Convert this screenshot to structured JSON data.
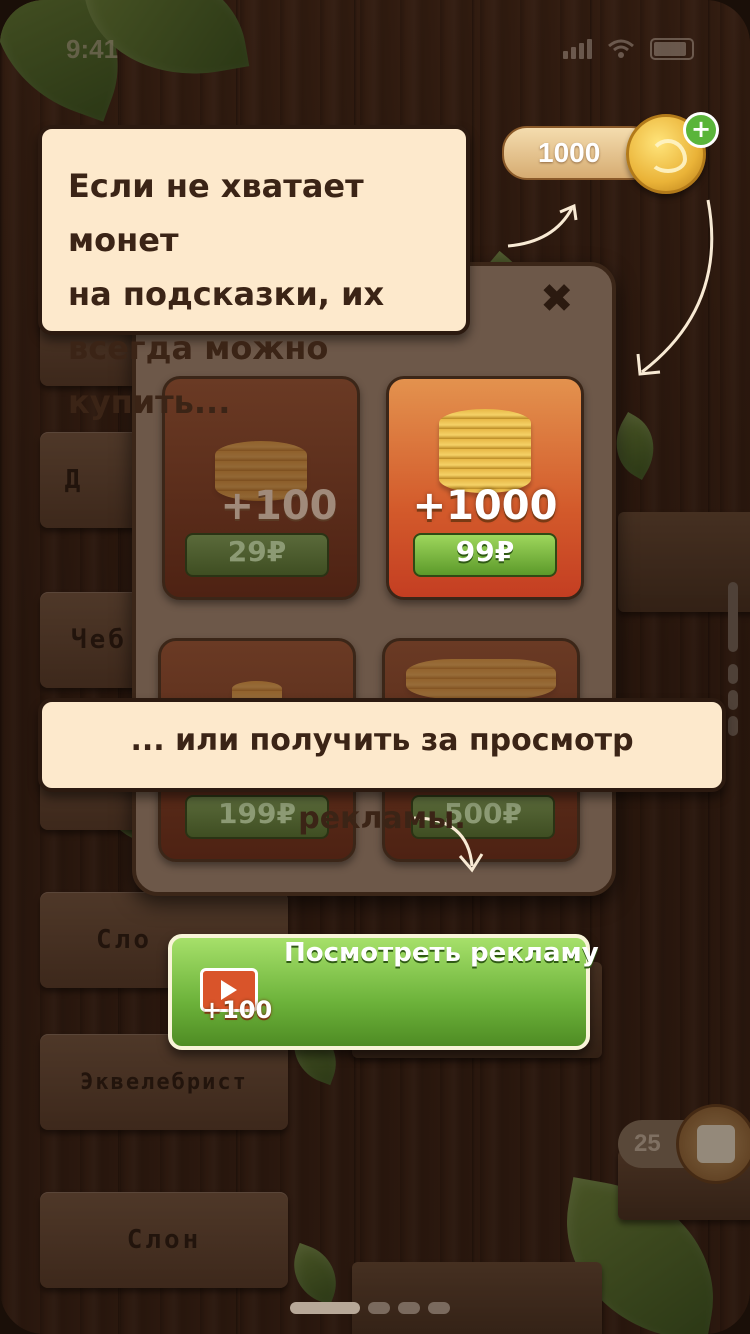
{
  "status_bar": {
    "time": "9:41"
  },
  "balance": {
    "coins": "1000",
    "add_icon": "plus-icon"
  },
  "tooltip_top": {
    "lines": [
      "Если не хватает монет",
      "на подсказки, их",
      "всегда можно купить..."
    ]
  },
  "tooltip_mid": {
    "text": "... или получить за просмотр рекламы."
  },
  "shop": {
    "close_icon": "close-icon",
    "packs": [
      {
        "amount": "+100",
        "price": "29₽"
      },
      {
        "amount": "+1000",
        "price": "99₽"
      },
      {
        "amount": "",
        "price": "199₽"
      },
      {
        "amount": "",
        "price": "500₽"
      }
    ]
  },
  "ad_button": {
    "label": "Посмотреть рекламу",
    "badge": "+100",
    "icon": "tv-play-icon"
  },
  "background_words": [
    "Д",
    "Чеб",
    "Сло",
    "Эквелебрист",
    "Слон"
  ],
  "hints": {
    "count": "25",
    "icon": "dice-icon"
  },
  "colors": {
    "accent_green": "#6cb23a",
    "tooltip_bg": "#fde9cc",
    "best_card": "#d35a2b"
  }
}
